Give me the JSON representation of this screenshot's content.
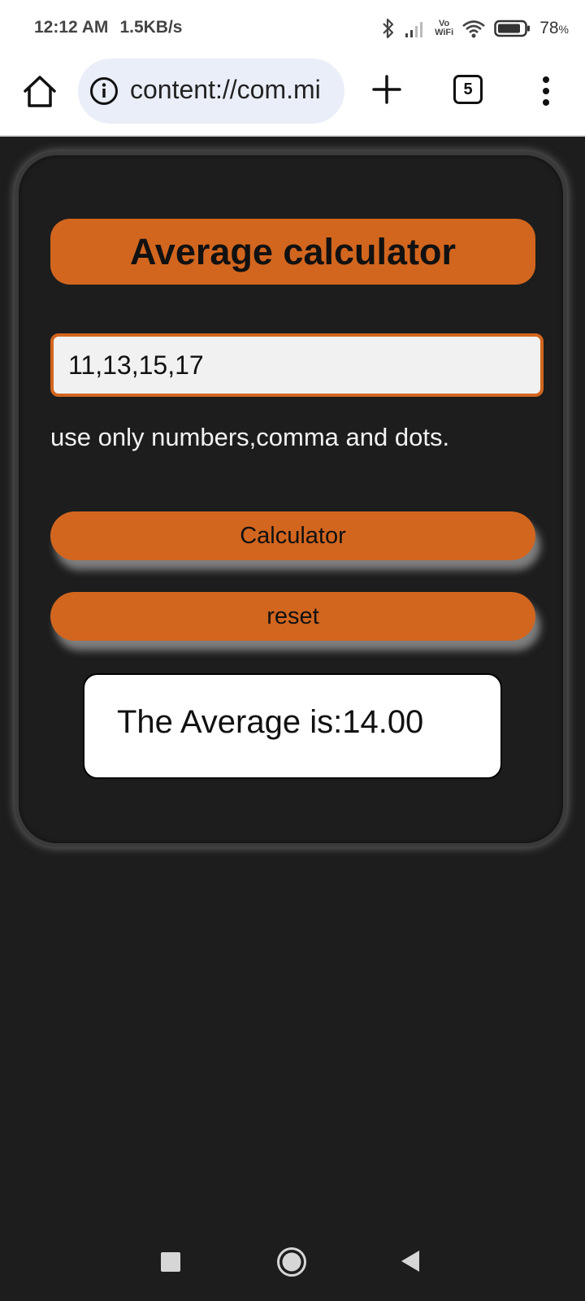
{
  "status_bar": {
    "time": "12:12 AM",
    "speed": "1.5KB/s",
    "vowifi_top": "Vo",
    "vowifi_bottom": "WiFi",
    "battery": "78",
    "battery_unit": "%",
    "icons": [
      "bluetooth-icon",
      "signal-icon",
      "wifi-icon",
      "battery-icon"
    ]
  },
  "toolbar": {
    "url": "content://com.mi",
    "tab_count": "5",
    "icons": [
      "home-icon",
      "info-icon",
      "plus-icon",
      "tab-switcher-icon",
      "more-vert-icon"
    ]
  },
  "app": {
    "title": "Average calculator",
    "input_value": "11,13,15,17",
    "hint": "use only numbers,comma and dots.",
    "calc_label": "Calculator",
    "reset_label": "reset",
    "result": "The Average is:14.00"
  },
  "colors": {
    "accent": "#d2661f",
    "background": "#1d1d1d",
    "card_border": "#3a3a3a"
  },
  "nav": {
    "icons": [
      "recents-square-icon",
      "home-circle-icon",
      "back-triangle-icon"
    ]
  }
}
